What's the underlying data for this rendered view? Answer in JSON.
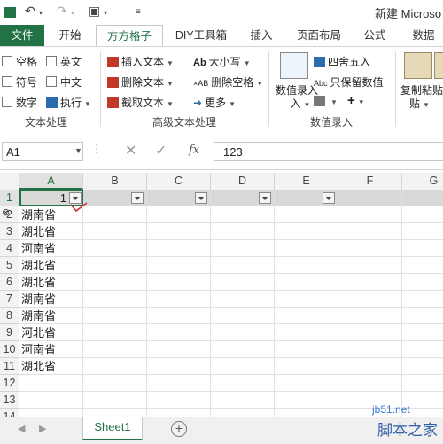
{
  "title": "新建 Microso",
  "tabs": {
    "file": "文件",
    "home": "开始",
    "ffgz": "方方格子",
    "diy": "DIY工具箱",
    "insert": "插入",
    "layout": "页面布局",
    "formula": "公式",
    "data": "数据"
  },
  "ribbon": {
    "text_group": {
      "label": "文本处理",
      "items": [
        "空格",
        "英文",
        "符号",
        "中文",
        "数字",
        "执行"
      ]
    },
    "adv_group": {
      "label": "高级文本处理",
      "insert_text": "插入文本",
      "delete_text": "删除文本",
      "extract_text": "截取文本",
      "case": "大小写",
      "delete_space": "删除空格",
      "more": "更多"
    },
    "num_group": {
      "label": "数值录入",
      "value_entry": "数值录入",
      "round": "四舍五入",
      "keep_value": "只保留数值",
      "plus": "+",
      "copy_paste": "复制粘贴"
    }
  },
  "formula_bar": {
    "name_box": "A1",
    "fx": "fx",
    "value": "123"
  },
  "grid": {
    "columns": [
      "A",
      "B",
      "C",
      "D",
      "E",
      "F",
      "G"
    ],
    "rows": [
      "1",
      "2",
      "3",
      "4",
      "5",
      "6",
      "7",
      "8",
      "9",
      "10",
      "11",
      "12",
      "13",
      "14"
    ],
    "a1_value": "1",
    "column_a": [
      "湖南省",
      "湖北省",
      "河南省",
      "湖北省",
      "湖北省",
      "湖南省",
      "湖南省",
      "河北省",
      "河南省",
      "湖北省"
    ]
  },
  "sheets": {
    "active": "Sheet1",
    "add": "+"
  },
  "watermark": {
    "line1": "jb51.net",
    "line2": "脚本之家"
  },
  "colors": {
    "accent": "#217346",
    "selected_row": "#d9d9d9"
  }
}
